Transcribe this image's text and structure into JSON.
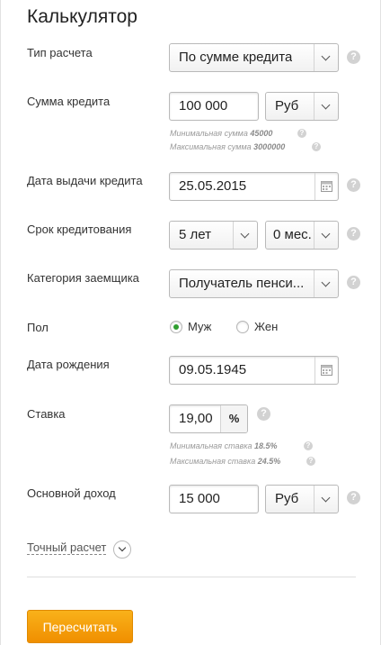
{
  "title": "Калькулятор",
  "calc_type": {
    "label": "Тип расчета",
    "value": "По сумме кредита"
  },
  "loan_amount": {
    "label": "Сумма кредита",
    "value": "100 000",
    "currency": "Руб",
    "hint_min_prefix": "Минимальная сумма",
    "hint_min_value": "45000",
    "hint_max_prefix": "Максимальная сумма",
    "hint_max_value": "3000000"
  },
  "issue_date": {
    "label": "Дата выдачи кредита",
    "value": "25.05.2015"
  },
  "term": {
    "label": "Срок кредитования",
    "years": "5 лет",
    "months": "0 мес."
  },
  "borrower_category": {
    "label": "Категория заемщика",
    "value": "Получатель пенси..."
  },
  "gender": {
    "label": "Пол",
    "male": "Муж",
    "female": "Жен",
    "selected": "male"
  },
  "birth_date": {
    "label": "Дата рождения",
    "value": "09.05.1945"
  },
  "rate": {
    "label": "Ставка",
    "value": "19,00",
    "unit": "%",
    "hint_min_prefix": "Минимальная ставка",
    "hint_min_value": "18.5%",
    "hint_max_prefix": "Максимальная ставка",
    "hint_max_value": "24.5%"
  },
  "income": {
    "label": "Основной доход",
    "value": "15 000",
    "currency": "Руб"
  },
  "exact_calc": {
    "label": "Точный расчет"
  },
  "recalc_button": {
    "label": "Пересчитать"
  },
  "help_glyph": "?",
  "colors": {
    "accent_button": "#f5a00f",
    "radio_selected": "#2f9e2f",
    "help_icon": "#d2d2d2"
  }
}
